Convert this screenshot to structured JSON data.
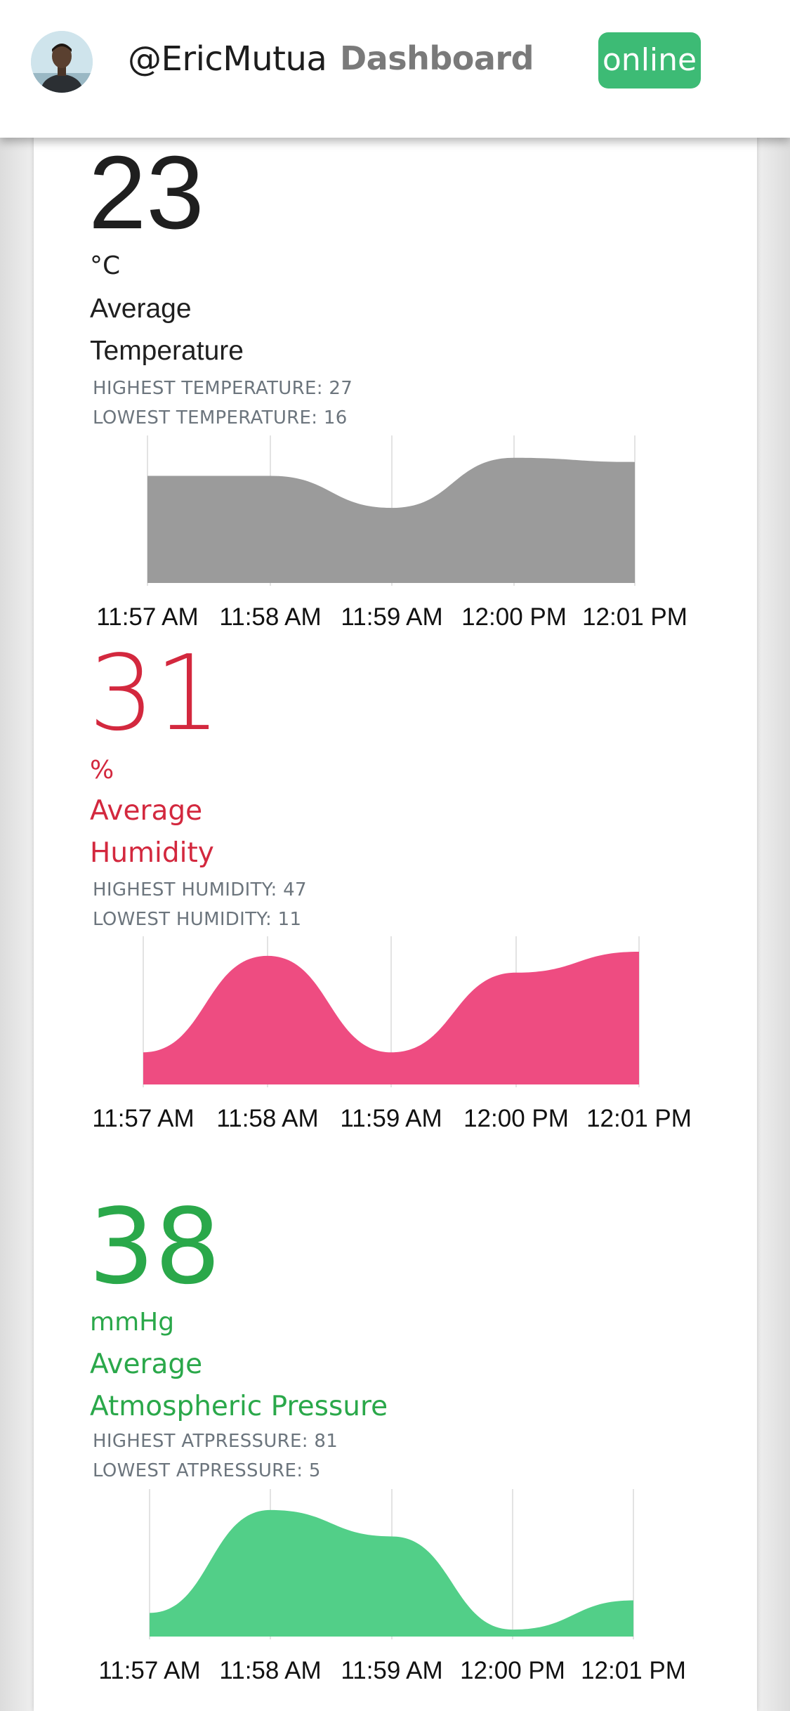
{
  "header": {
    "username": "@EricMutua",
    "nav_label": "Dashboard",
    "status_label": "online"
  },
  "metrics": [
    {
      "value": "23",
      "unit": "°C",
      "label_line1": "Average",
      "label_line2": "Temperature",
      "highest": "HIGHEST TEMPERATURE: 27",
      "lowest": "LOWEST TEMPERATURE: 16"
    },
    {
      "value": "31",
      "unit": "%",
      "label_line1": "Average",
      "label_line2": "Humidity",
      "highest": "HIGHEST HUMIDITY: 47",
      "lowest": "LOWEST HUMIDITY: 11"
    },
    {
      "value": "38",
      "unit": "mmHg",
      "label_line1": "Average",
      "label_line2": "Atmospheric Pressure",
      "highest": "HIGHEST ATPRESSURE: 81",
      "lowest": "LOWEST ATPRESSURE: 5"
    }
  ],
  "colors": {
    "status_online": "#3dbb75",
    "temperature_fill": "#9b9b9b",
    "humidity_fill": "#ee4c81",
    "pressure_fill": "#52cf88",
    "humidity_text": "#d3283e",
    "pressure_text": "#2aa84a"
  },
  "chart_data": [
    {
      "type": "area",
      "x": [
        "11:57 AM",
        "11:58 AM",
        "11:59 AM",
        "12:00 PM",
        "12:01 PM"
      ],
      "series": [
        {
          "values": [
            0.77,
            0.77,
            0.54,
            0.9,
            0.87
          ]
        }
      ],
      "color": "#9b9b9b",
      "grid": "vertical",
      "ylim": [
        0,
        1
      ]
    },
    {
      "type": "area",
      "x": [
        "11:57 AM",
        "11:58 AM",
        "11:59 AM",
        "12:00 PM",
        "12:01 PM"
      ],
      "series": [
        {
          "values": [
            0.23,
            0.92,
            0.23,
            0.8,
            0.95
          ]
        }
      ],
      "color": "#ee4c81",
      "grid": "vertical",
      "ylim": [
        0,
        1
      ]
    },
    {
      "type": "area",
      "x": [
        "11:57 AM",
        "11:58 AM",
        "11:59 AM",
        "12:00 PM",
        "12:01 PM"
      ],
      "series": [
        {
          "values": [
            0.17,
            0.91,
            0.72,
            0.05,
            0.26
          ]
        }
      ],
      "color": "#52cf88",
      "grid": "vertical",
      "ylim": [
        0,
        1
      ]
    }
  ]
}
